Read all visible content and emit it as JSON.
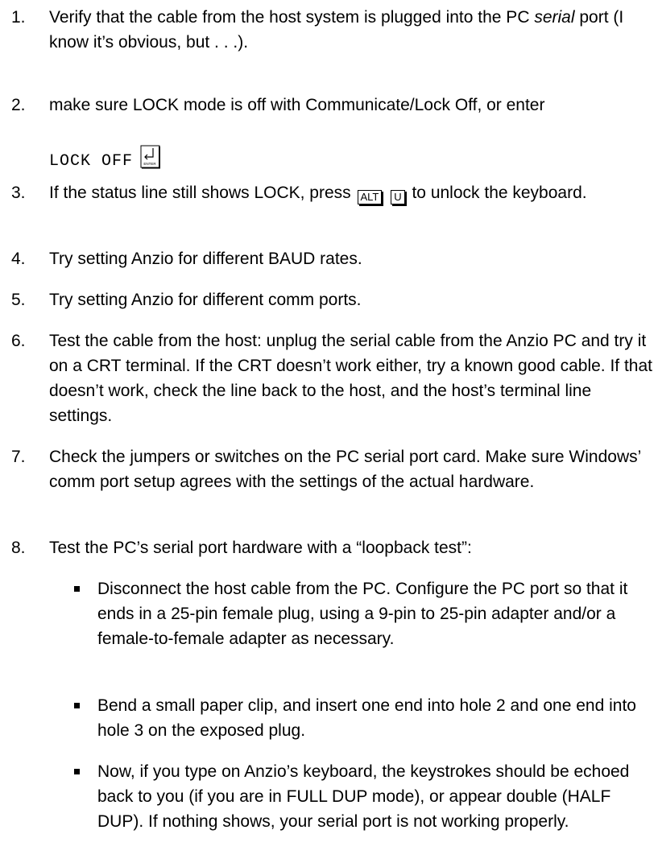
{
  "items": [
    {
      "num": "1.",
      "pre": "Verify that the cable from the host system is plugged into the PC ",
      "em": "serial",
      "post": " port (I know it’s obvious, but . . .)."
    },
    {
      "num": "2.",
      "text": "make sure LOCK mode is off with Communicate/Lock Off, or enter",
      "code": "LOCK OFF",
      "enter_key_label": "ENTER"
    },
    {
      "num": "3.",
      "pre": "If the status line still shows LOCK, press",
      "key1": "ALT",
      "key2": "U",
      "post": "to unlock the keyboard."
    },
    {
      "num": "4.",
      "text": "Try setting Anzio for different BAUD rates."
    },
    {
      "num": "5.",
      "text": "Try setting Anzio for different comm ports."
    },
    {
      "num": "6.",
      "text": "Test the cable from the host:  unplug the serial cable from the Anzio PC and try it on a CRT terminal.  If the CRT doesn’t work either, try a known good cable.  If that doesn’t work, check the line back to the host, and the host’s terminal line settings."
    },
    {
      "num": "7.",
      "text": "Check the jumpers or switches on the PC serial port card.  Make sure Windows’ comm port setup agrees with the settings of the actual hardware."
    },
    {
      "num": "8.",
      "text": "Test the PC’s serial port hardware with a “loopback test”:"
    }
  ],
  "bullets": [
    "Disconnect the host cable from the PC.  Configure the PC port so that it ends in a 25-pin female plug, using a 9-pin to 25-pin adapter and/or a female-to-female adapter as necessary.",
    "Bend a small paper clip, and insert one end into hole 2 and one end into hole 3 on the exposed plug.",
    "Now, if you type on Anzio’s keyboard, the keystrokes should be echoed back to you (if you are in FULL DUP mode), or appear double (HALF DUP).  If nothing shows, your serial port is not working properly."
  ]
}
